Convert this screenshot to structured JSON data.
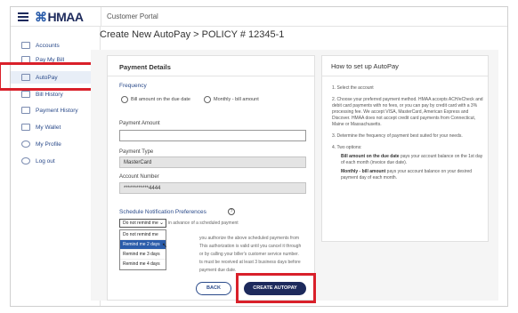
{
  "header": {
    "logo_text": "HMAA",
    "portal_title": "Customer Portal"
  },
  "sidebar": {
    "items": [
      {
        "label": "Accounts",
        "icon": "accounts-icon"
      },
      {
        "label": "Pay My Bill",
        "icon": "pay-bill-icon"
      },
      {
        "label": "AutoPay",
        "icon": "autopay-icon"
      },
      {
        "label": "Bill History",
        "icon": "bill-history-icon"
      },
      {
        "label": "Payment History",
        "icon": "payment-history-icon"
      },
      {
        "label": "My Wallet",
        "icon": "wallet-icon"
      },
      {
        "label": "My Profile",
        "icon": "profile-icon"
      },
      {
        "label": "Log out",
        "icon": "logout-icon"
      }
    ],
    "active_index": 2
  },
  "page": {
    "title": "Create New AutoPay > POLICY # 12345-1"
  },
  "payment_details": {
    "title": "Payment Details",
    "frequency_label": "Frequency",
    "freq_option_1": "Bill amount on the due date",
    "freq_option_2": "Monthly - bill amount",
    "payment_amount_label": "Payment Amount",
    "payment_amount_value": "",
    "payment_type_label": "Payment Type",
    "payment_type_value": "MasterCard",
    "account_number_label": "Account Number",
    "account_number_value": "************4444",
    "notif_label": "Schedule Notification Preferences",
    "notif_selected": "Do not remind me",
    "notif_suffix": "in advance of a scheduled payment",
    "notif_options": [
      "Do not remind me",
      "Remind me 2 days",
      "Remind me 3 days",
      "Remind me 4 days"
    ],
    "notif_highlight_index": 1,
    "auth_line_1": "you authorize the above scheduled payments from",
    "auth_line_2": "This authorization is valid until you cancel it through",
    "auth_line_3": "or by calling your biller's customer service number.",
    "auth_line_4": "ts must be received at least 3 business days before",
    "auth_line_5": "payment due date."
  },
  "buttons": {
    "back": "BACK",
    "create": "CREATE AUTOPAY"
  },
  "help": {
    "title": "How to set up AutoPay",
    "step_1": "1. Select the account",
    "step_2": "2. Choose your preferred payment method. HMAA accepts ACH/eCheck and debit card payments with no fees, or you can pay by credit card with a 3% processing fee. We accept VISA, MasterCard, American Express and Discover. HMAA does not accept credit card payments from Connecticut, Maine or Massachusetts.",
    "step_3": "3. Determine the frequency of payment best suited for your needs.",
    "step_4": "4. Two options:",
    "opt_1_bold": "Bill amount on the due date",
    "opt_1_rest": " pays your account balance on the 1st day of each month (invoice due date).",
    "opt_2_bold": "Monthly - bill amount",
    "opt_2_rest": " pays your account balance on your desired payment day of each month."
  },
  "colors": {
    "brand_navy": "#1d2a5c",
    "highlight_red": "#d9202a",
    "link_blue": "#2a4a8a"
  }
}
